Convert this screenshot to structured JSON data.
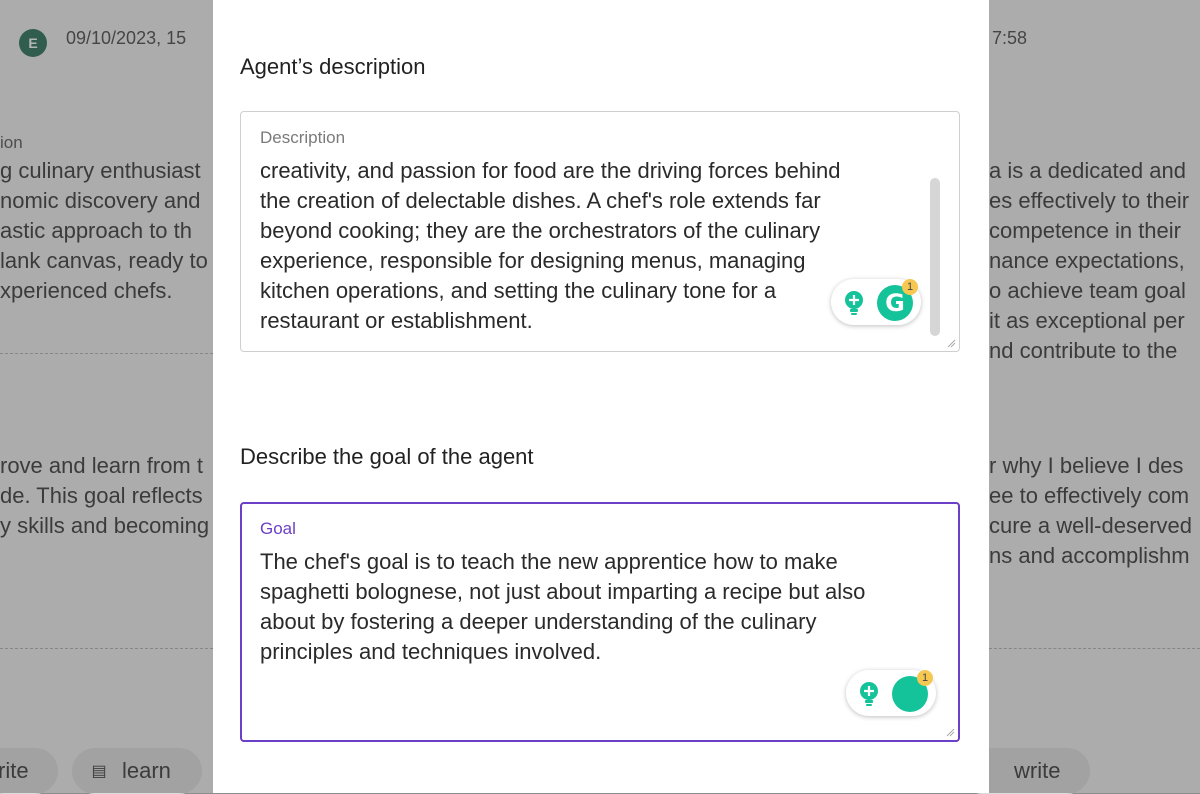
{
  "background": {
    "avatar_initial": "E",
    "timestamp_left": "09/10/2023, 15",
    "timestamp_right": "7:58",
    "left_top_label": "ion",
    "left_top_lines": [
      "g culinary enthusiast",
      "nomic discovery and",
      "astic approach to th",
      "lank canvas, ready to",
      "xperienced chefs."
    ],
    "right_top_lines": [
      "a is a dedicated and",
      "es effectively to their",
      "competence in their",
      "nance expectations,",
      "o achieve team goal",
      "it as exceptional per",
      "nd contribute to the"
    ],
    "left_mid_lines": [
      "rove and learn from t",
      "de. This goal reflects",
      "y skills and becoming"
    ],
    "right_mid_lines": [
      "r why I believe I des",
      "ee to effectively com",
      "cure a well-deserved",
      "ns and accomplishm"
    ],
    "chips": {
      "left_write": "rite",
      "learn": "learn",
      "right_write": "write"
    }
  },
  "modal": {
    "description_section_title": "Agent’s description",
    "description_field": {
      "label": "Description",
      "lines": [
        "creativity, and passion for food are the driving forces behind",
        "the creation of delectable dishes. A chef's role extends far",
        "beyond cooking; they are the orchestrators of the culinary",
        "experience, responsible for designing menus, managing",
        "kitchen operations, and setting the culinary tone for a",
        "restaurant or establishment."
      ]
    },
    "goal_section_title": "Describe the goal of the agent",
    "goal_field": {
      "label": "Goal",
      "lines": [
        "The chef's goal is to teach the new apprentice how to make",
        "spaghetti bolognese, not just about imparting a recipe but also",
        "about by fostering a deeper understanding of the culinary",
        "principles and techniques involved."
      ]
    },
    "grammarly": {
      "letter": "G",
      "badge_count": "1"
    }
  },
  "colors": {
    "accent_focus": "#6b3fc6",
    "grammarly_green": "#15c39a",
    "badge_yellow": "#f6c851",
    "avatar_green": "#0f5f45"
  }
}
